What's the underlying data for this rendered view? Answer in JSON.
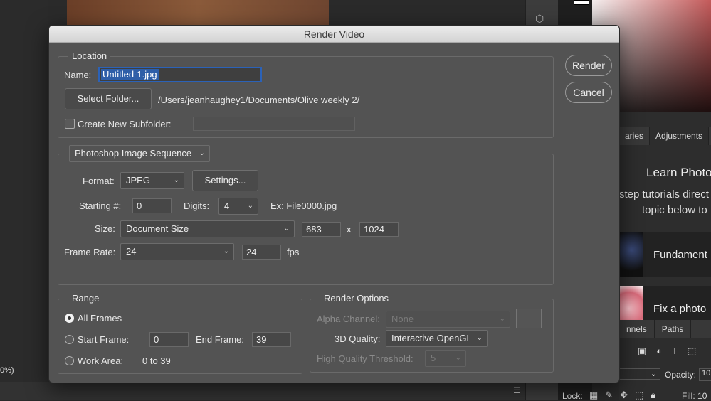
{
  "background": {
    "zoom_text": "0%)",
    "tabs_top": [
      "aries",
      "Adjustments"
    ],
    "learn_title": "Learn Photo",
    "learn_sub1": "step tutorials direct",
    "learn_sub2": "topic below to",
    "card1_label": "Fundament",
    "card2_label": "Fix a photo",
    "tabs_bottom": [
      "nnels",
      "Paths"
    ],
    "opacity_label": "Opacity:",
    "opacity_value": "10",
    "lock_label": "Lock:",
    "fill_label": "Fill:",
    "fill_value": "10"
  },
  "dialog": {
    "title": "Render Video",
    "render_label": "Render",
    "cancel_label": "Cancel",
    "location": {
      "legend": "Location",
      "name_label": "Name:",
      "name_value": "Untitled-1.jpg",
      "select_folder_label": "Select Folder...",
      "folder_path": "/Users/jeanhaughey1/Documents/Olive weekly 2/",
      "subfolder_label": "Create New Subfolder:",
      "subfolder_value": "",
      "subfolder_checked": false
    },
    "sequence": {
      "type_value": "Photoshop Image Sequence",
      "format_label": "Format:",
      "format_value": "JPEG",
      "settings_label": "Settings...",
      "starting_label": "Starting #:",
      "starting_value": "0",
      "digits_label": "Digits:",
      "digits_value": "4",
      "example_text": "Ex: File0000.jpg",
      "size_label": "Size:",
      "size_value": "Document Size",
      "width_value": "683",
      "x_label": "x",
      "height_value": "1024",
      "frame_rate_label": "Frame Rate:",
      "frame_rate_value": "24",
      "fps_value": "24",
      "fps_label": "fps"
    },
    "range": {
      "legend": "Range",
      "all_frames_label": "All Frames",
      "start_frame_label": "Start Frame:",
      "start_frame_value": "0",
      "end_frame_label": "End Frame:",
      "end_frame_value": "39",
      "work_area_label": "Work Area:",
      "work_area_value": "0 to 39",
      "selected": "all_frames"
    },
    "render_options": {
      "legend": "Render Options",
      "alpha_label": "Alpha Channel:",
      "alpha_value": "None",
      "quality_label": "3D Quality:",
      "quality_value": "Interactive OpenGL",
      "threshold_label": "High Quality Threshold:",
      "threshold_value": "5"
    }
  },
  "colors": {
    "dialog_bg": "#535353",
    "focus_ring": "#2b62b8",
    "selection": "#2e5ea8"
  }
}
